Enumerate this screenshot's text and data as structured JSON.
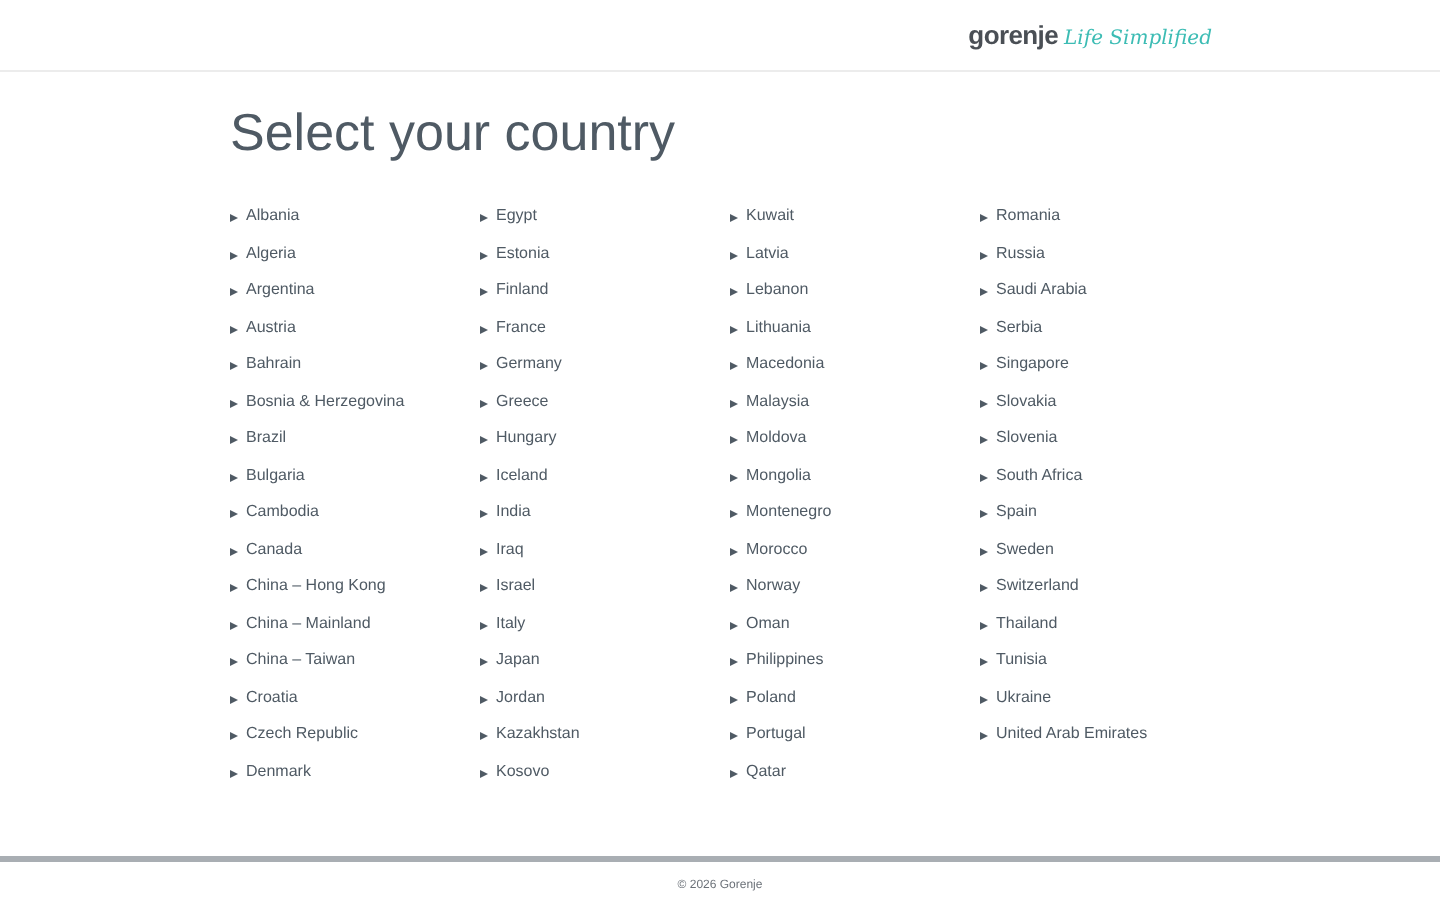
{
  "header": {
    "brand": "gorenje",
    "tagline": "Life Simplified"
  },
  "title": "Select your country",
  "columns": [
    [
      "Albania",
      "Algeria",
      "Argentina",
      "Austria",
      "Bahrain",
      "Bosnia & Herzegovina",
      "Brazil",
      "Bulgaria",
      "Cambodia",
      "Canada",
      "China – Hong Kong",
      "China – Mainland",
      "China – Taiwan",
      "Croatia",
      "Czech Republic",
      "Denmark"
    ],
    [
      "Egypt",
      "Estonia",
      "Finland",
      "France",
      "Germany",
      "Greece",
      "Hungary",
      "Iceland",
      "India",
      "Iraq",
      "Israel",
      "Italy",
      "Japan",
      "Jordan",
      "Kazakhstan",
      "Kosovo"
    ],
    [
      "Kuwait",
      "Latvia",
      "Lebanon",
      "Lithuania",
      "Macedonia",
      "Malaysia",
      "Moldova",
      "Mongolia",
      "Montenegro",
      "Morocco",
      "Norway",
      "Oman",
      "Philippines",
      "Poland",
      "Portugal",
      "Qatar"
    ],
    [
      "Romania",
      "Russia",
      "Saudi Arabia",
      "Serbia",
      "Singapore",
      "Slovakia",
      "Slovenia",
      "South Africa",
      "Spain",
      "Sweden",
      "Switzerland",
      "Thailand",
      "Tunisia",
      "Ukraine",
      "United Arab Emirates"
    ]
  ],
  "footer": "© 2026 Gorenje"
}
